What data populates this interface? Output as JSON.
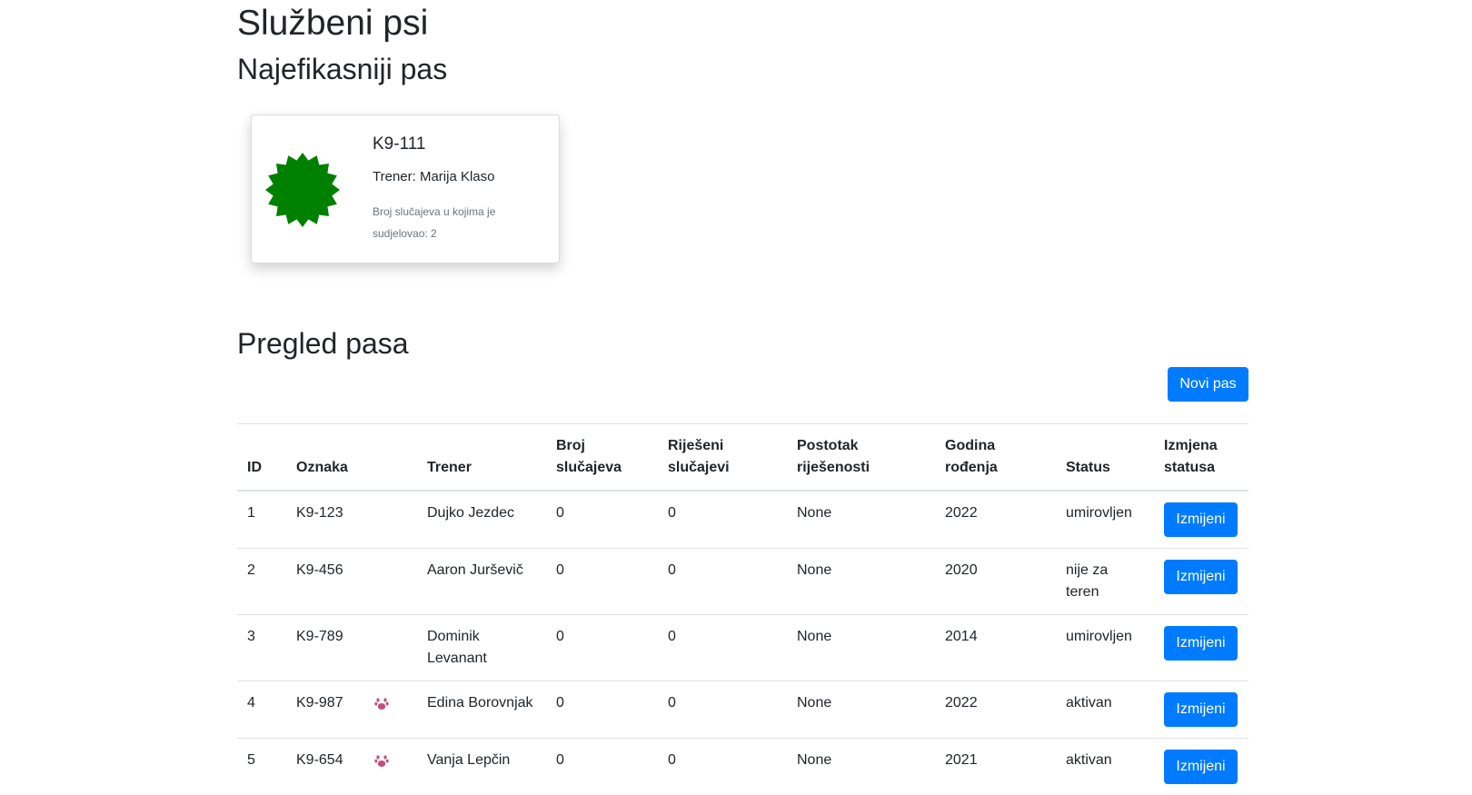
{
  "page": {
    "title": "Službeni psi",
    "best_heading": "Najefikasniji pas",
    "list_heading": "Pregled pasa"
  },
  "best_dog": {
    "icon": "badge-icon",
    "icon_color": "#008000",
    "label": "K9-111",
    "trainer": "Trener: Marija Klaso",
    "cases": "Broj slučajeva u kojima je sudjelovao: 2"
  },
  "actions": {
    "new_dog": "Novi pas"
  },
  "colors": {
    "primary": "#007bff",
    "paw": "#c2507f",
    "badge": "#008000"
  },
  "table": {
    "headers": {
      "id": "ID",
      "label": "Oznaka",
      "trainer": "Trener",
      "cases": "Broj slučajeva",
      "solved": "Riješeni slučajevi",
      "percent": "Postotak riješenosti",
      "birth": "Godina rođenja",
      "status": "Status",
      "change": "Izmjena statusa"
    },
    "rows": [
      {
        "id": "1",
        "label": "K9-123",
        "paw": false,
        "trainer": "Dujko Jezdec",
        "cases": "0",
        "solved": "0",
        "percent": "None",
        "birth": "2022",
        "status": "umirovljen",
        "button": "Izmijeni"
      },
      {
        "id": "2",
        "label": "K9-456",
        "paw": false,
        "trainer": "Aaron Jurševič",
        "cases": "0",
        "solved": "0",
        "percent": "None",
        "birth": "2020",
        "status": "nije za teren",
        "button": "Izmijeni"
      },
      {
        "id": "3",
        "label": "K9-789",
        "paw": false,
        "trainer": "Dominik Levanant",
        "cases": "0",
        "solved": "0",
        "percent": "None",
        "birth": "2014",
        "status": "umirovljen",
        "button": "Izmijeni"
      },
      {
        "id": "4",
        "label": "K9-987",
        "paw": true,
        "trainer": "Edina Borovnjak",
        "cases": "0",
        "solved": "0",
        "percent": "None",
        "birth": "2022",
        "status": "aktivan",
        "button": "Izmijeni"
      },
      {
        "id": "5",
        "label": "K9-654",
        "paw": true,
        "trainer": "Vanja Lepčin",
        "cases": "0",
        "solved": "0",
        "percent": "None",
        "birth": "2021",
        "status": "aktivan",
        "button": "Izmijeni"
      }
    ]
  }
}
